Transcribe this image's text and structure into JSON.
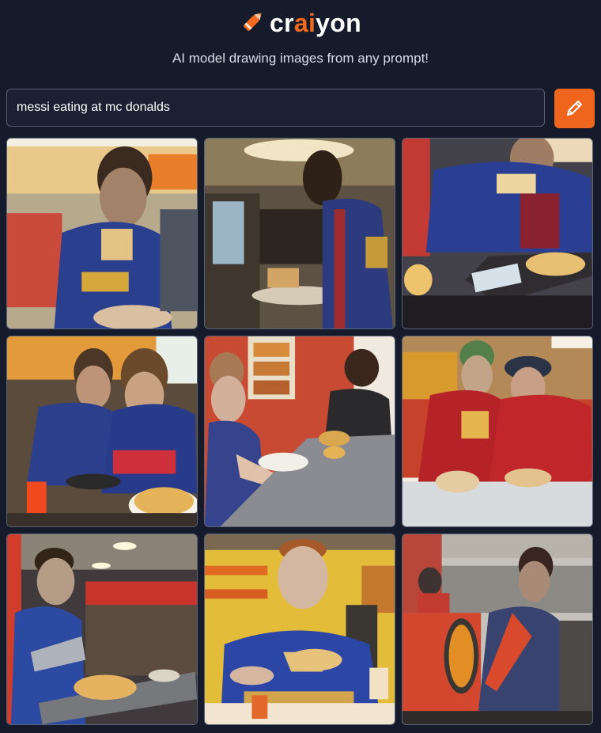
{
  "brand": {
    "name_prefix": "cr",
    "name_highlight": "ai",
    "name_suffix": "yon",
    "accent_color": "#f26a1b"
  },
  "tagline": "AI model drawing images from any prompt!",
  "search": {
    "value": "messi eating at mc donalds",
    "placeholder": ""
  },
  "draw_button": {
    "icon": "pencil-icon"
  },
  "results": [
    {
      "id": "1",
      "scene": "restaurant-counter"
    },
    {
      "id": "2",
      "scene": "restaurant-interior"
    },
    {
      "id": "3",
      "scene": "table-closeup"
    },
    {
      "id": "4",
      "scene": "two-diners"
    },
    {
      "id": "5",
      "scene": "boy-at-table"
    },
    {
      "id": "6",
      "scene": "red-shirts"
    },
    {
      "id": "7",
      "scene": "blue-shirt-counter"
    },
    {
      "id": "8",
      "scene": "yellow-interior"
    },
    {
      "id": "9",
      "scene": "back-view"
    }
  ]
}
